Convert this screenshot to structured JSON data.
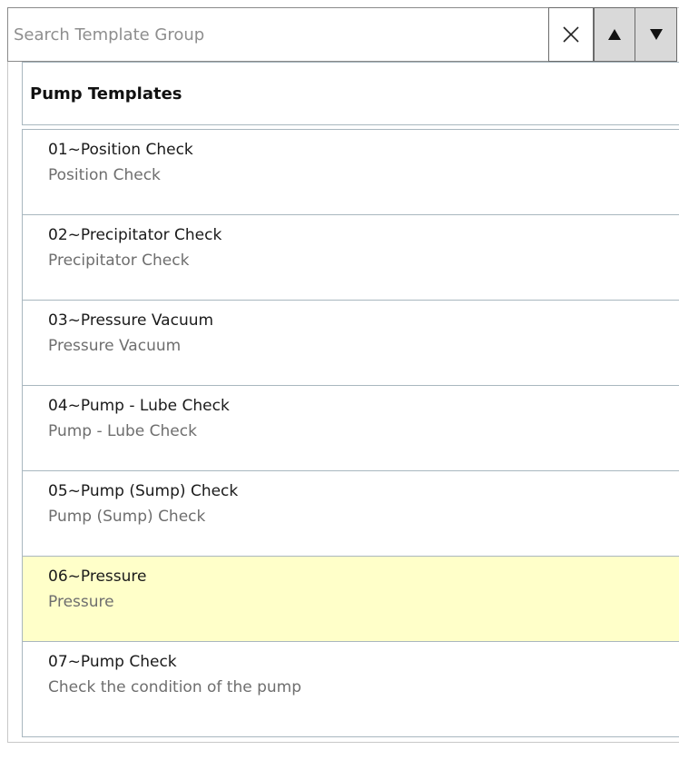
{
  "search": {
    "placeholder": "Search Template Group",
    "value": ""
  },
  "icons": {
    "clear": "close-icon",
    "up": "triangle-up-icon",
    "down": "triangle-down-icon"
  },
  "group": {
    "title": "Pump Templates"
  },
  "templates": [
    {
      "title": "01~Position Check",
      "description": "Position Check",
      "selected": false
    },
    {
      "title": "02~Precipitator Check",
      "description": "Precipitator Check",
      "selected": false
    },
    {
      "title": "03~Pressure Vacuum",
      "description": "Pressure Vacuum",
      "selected": false
    },
    {
      "title": "04~Pump - Lube Check",
      "description": "Pump - Lube Check",
      "selected": false
    },
    {
      "title": "05~Pump (Sump) Check",
      "description": "Pump (Sump) Check",
      "selected": false
    },
    {
      "title": "06~Pressure",
      "description": "Pressure",
      "selected": true
    },
    {
      "title": "07~Pump Check",
      "description": "Check the condition of the pump",
      "selected": false
    }
  ],
  "colors": {
    "selected_row": "#ffffc9",
    "border": "#a9b7bf"
  }
}
